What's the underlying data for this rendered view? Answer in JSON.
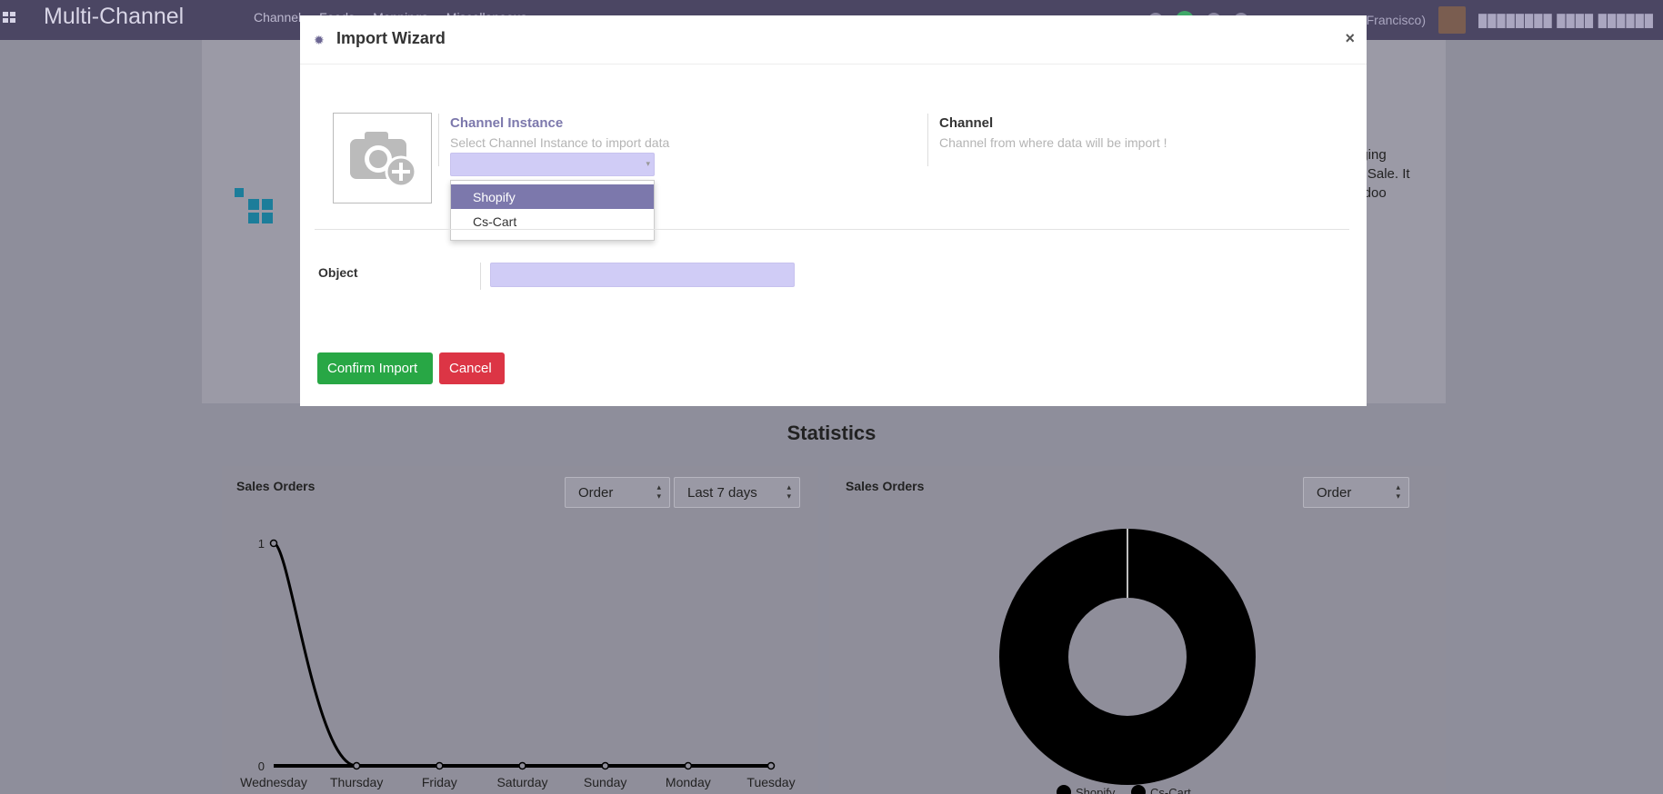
{
  "navbar": {
    "brand": "Multi-Channel",
    "menu": [
      "Channel",
      "Feeds",
      "Mappings",
      "Miscellaneous"
    ],
    "company": "MyCompany (San Francisco)",
    "user": "████████ ████ ██████"
  },
  "dashboard": {
    "intro_lines": [
      "aging",
      "el Sale. It",
      "Odoo"
    ],
    "statistics_title": "Statistics",
    "left_panel": {
      "title": "Sales Orders",
      "filter_type": "Order",
      "filter_period": "Last 7 days"
    },
    "right_panel": {
      "title": "Sales Orders",
      "filter_type": "Order"
    }
  },
  "chart_data": [
    {
      "type": "line",
      "x": [
        "Wednesday",
        "Thursday",
        "Friday",
        "Saturday",
        "Sunday",
        "Monday",
        "Tuesday"
      ],
      "series": [
        {
          "values": [
            1,
            0,
            0,
            0,
            0,
            0,
            0
          ]
        }
      ],
      "yticks": [
        "0",
        "1"
      ],
      "ylim": [
        0,
        1
      ]
    },
    {
      "type": "pie",
      "donut": true,
      "labels": [
        "Shopify",
        "Cs-Cart"
      ],
      "values": [
        1,
        0
      ],
      "colors": [
        "#000000",
        "#000000"
      ],
      "legend": "bottom"
    }
  ],
  "modal": {
    "title": "Import Wizard",
    "close": "×",
    "channel_instance": {
      "label": "Channel Instance",
      "help": "Select Channel Instance to import data",
      "value": "",
      "options": [
        "Shopify",
        "Cs-Cart"
      ],
      "highlighted": "Shopify"
    },
    "channel": {
      "label": "Channel",
      "help": "Channel from where data will be import !"
    },
    "object": {
      "label": "Object",
      "value": ""
    },
    "buttons": {
      "confirm": "Confirm Import",
      "cancel": "Cancel"
    }
  },
  "colors": {
    "navbar": "#4b4663",
    "accent": "#7c78ac",
    "field_bg": "#d0ccf6",
    "confirm": "#28a745",
    "cancel": "#dc3545",
    "logo": "#1c7d9a"
  }
}
